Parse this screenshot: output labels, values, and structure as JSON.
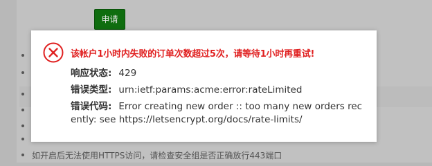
{
  "background": {
    "apply_button_label": "申请",
    "note": "如开启后无法使用HTTPS访问，请检查安全组是否正确放行443端口"
  },
  "dialog": {
    "title": "该帐户1小时内失败的订单次数超过5次，请等待1小时再重试!",
    "status_label": "响应状态:",
    "status_value": "429",
    "type_label": "错误类型:",
    "type_value": "urn:ietf:params:acme:error:rateLimited",
    "code_label": "错误代码:",
    "code_value_line1": "Error creating new order :: too many new orders rec",
    "code_value_line2": "ently: see https://letsencrypt.org/docs/rate-limits/",
    "icon": "error-x-icon",
    "colors": {
      "error_red": "#e02020",
      "apply_green": "#0f6d0f"
    }
  }
}
